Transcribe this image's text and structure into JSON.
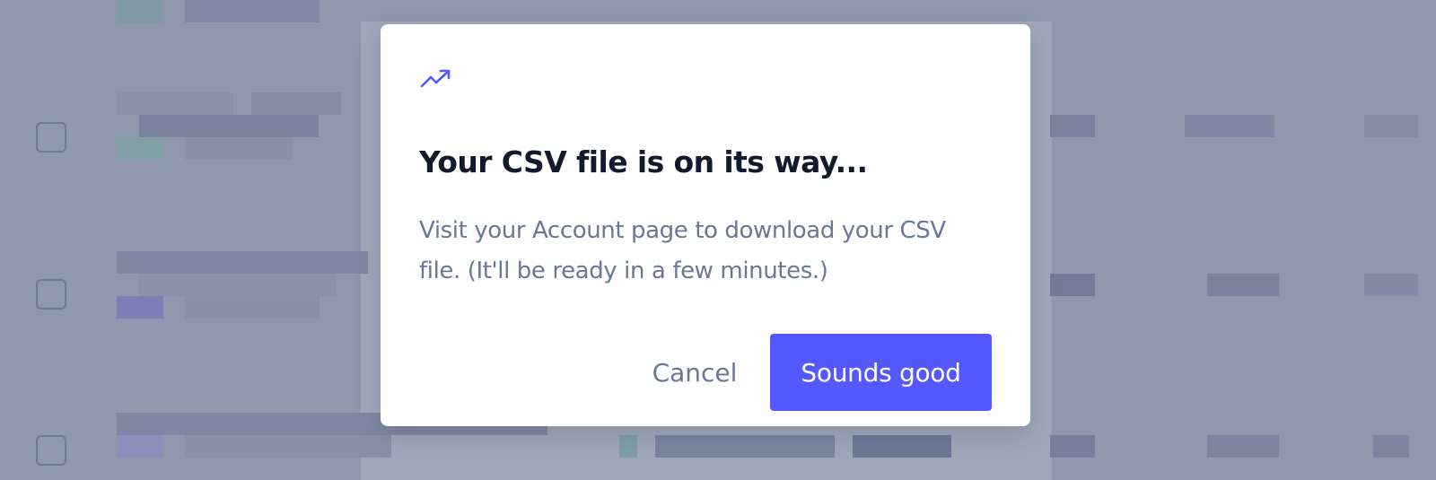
{
  "dialog": {
    "icon": "trending-up-icon",
    "title": "Your CSV file is on its way...",
    "message": "Visit your Account page to download your CSV file. (It'll be ready in a few minutes.)",
    "cancel_label": "Cancel",
    "confirm_label": "Sounds good"
  },
  "colors": {
    "accent": "#5459ff",
    "overlay": "#9098ae",
    "title": "#141a2e",
    "body_text": "#6b7797"
  }
}
